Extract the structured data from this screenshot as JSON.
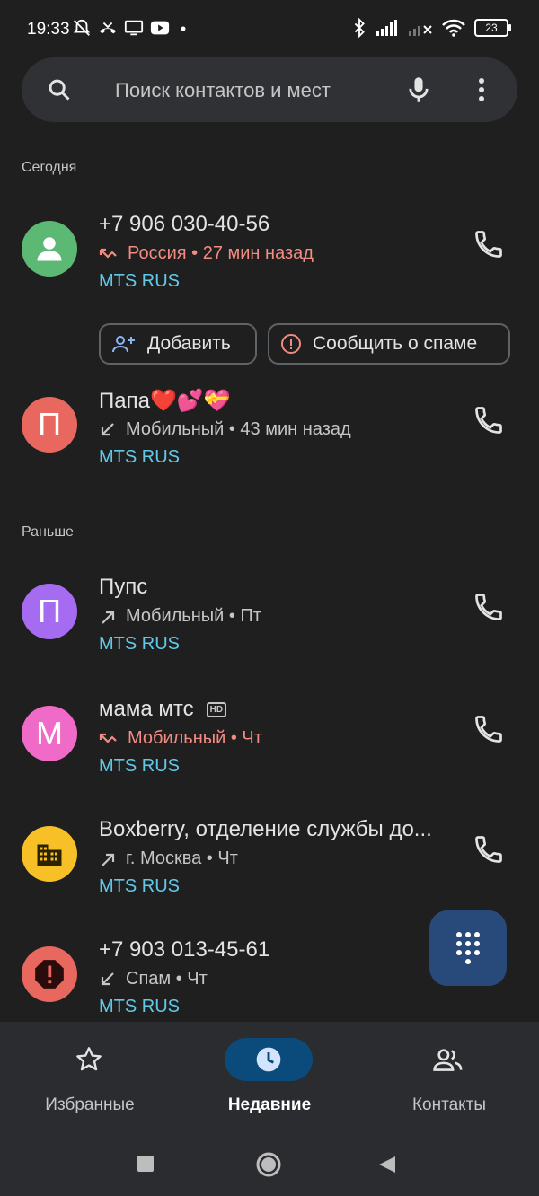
{
  "status_bar": {
    "time": "19:33",
    "battery": "23"
  },
  "search": {
    "placeholder": "Поиск контактов и мест"
  },
  "sections": {
    "today": "Сегодня",
    "earlier": "Раньше"
  },
  "calls": [
    {
      "name": "+7 906 030-40-56",
      "detail": "Россия • 27 мин назад",
      "carrier": "MTS RUS",
      "type": "missed",
      "avatar_color": "#5bb974",
      "avatar_letter": ""
    },
    {
      "name": "Папа❤️💕💝",
      "detail": "Мобильный • 43 мин назад",
      "carrier": "MTS RUS",
      "type": "incoming",
      "avatar_color": "#e8675e",
      "avatar_letter": "П"
    },
    {
      "name": "Пупс",
      "detail": "Мобильный • Пт",
      "carrier": "MTS RUS",
      "type": "outgoing",
      "avatar_color": "#a56bf0",
      "avatar_letter": "П"
    },
    {
      "name": "мама мтс",
      "detail": "Мобильный • Чт",
      "carrier": "MTS RUS",
      "type": "missed",
      "avatar_color": "#f06bc8",
      "avatar_letter": "М",
      "hd_badge": "HD"
    },
    {
      "name": "Boxberry, отделение службы до...",
      "detail": "г. Москва • Чт",
      "carrier": "MTS RUS",
      "type": "outgoing",
      "avatar_color": "#f6c026",
      "avatar_letter": ""
    },
    {
      "name": "+7 903 013-45-61",
      "detail": "Спам • Чт",
      "carrier": "MTS RUS",
      "type": "incoming",
      "avatar_color": "#e8675e",
      "avatar_letter": ""
    }
  ],
  "actions": {
    "add": "Добавить",
    "report_spam": "Сообщить о спаме"
  },
  "nav": {
    "favorites": "Избранные",
    "recents": "Недавние",
    "contacts": "Контакты"
  },
  "colors": {
    "accent": "#62c8e8",
    "missed": "#f28b82",
    "fab": "#284a7a"
  }
}
